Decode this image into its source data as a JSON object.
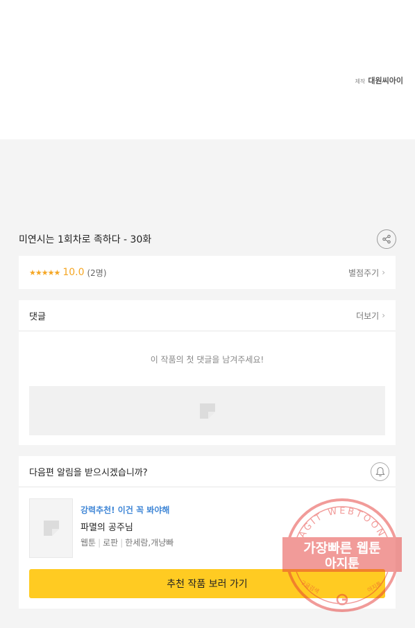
{
  "credit": {
    "label": "제작",
    "company": "대원씨아이"
  },
  "episode": {
    "title": "미연시는 1회차로 족하다 - 30화"
  },
  "rating": {
    "stars": "★★★★★",
    "score": "10.0",
    "count": "(2명)",
    "action": "별점주기"
  },
  "comments": {
    "heading": "댓글",
    "more": "더보기",
    "empty": "이 작품의 첫 댓글을 남겨주세요!"
  },
  "notify": {
    "question": "다음편 알림을 받으시겠습니까?",
    "recommend": {
      "tag": "강력추천! 이건 꼭 봐야해",
      "title": "파멸의 공주님",
      "genres": [
        "웹툰",
        "로판",
        "한세람,개냥빠"
      ],
      "button": "추천 작품 보러 가기"
    }
  },
  "watermark": {
    "line1": "가장빠른 웹툰",
    "line2": "아지툰",
    "ring": "AGIT WEBTOON",
    "small_left": "구글검색",
    "small_right": "아지툰"
  },
  "colors": {
    "accent_yellow": "#ffcb22",
    "star": "#f5a623",
    "tag_blue": "#3f86d6",
    "stamp_red": "#e53935"
  }
}
